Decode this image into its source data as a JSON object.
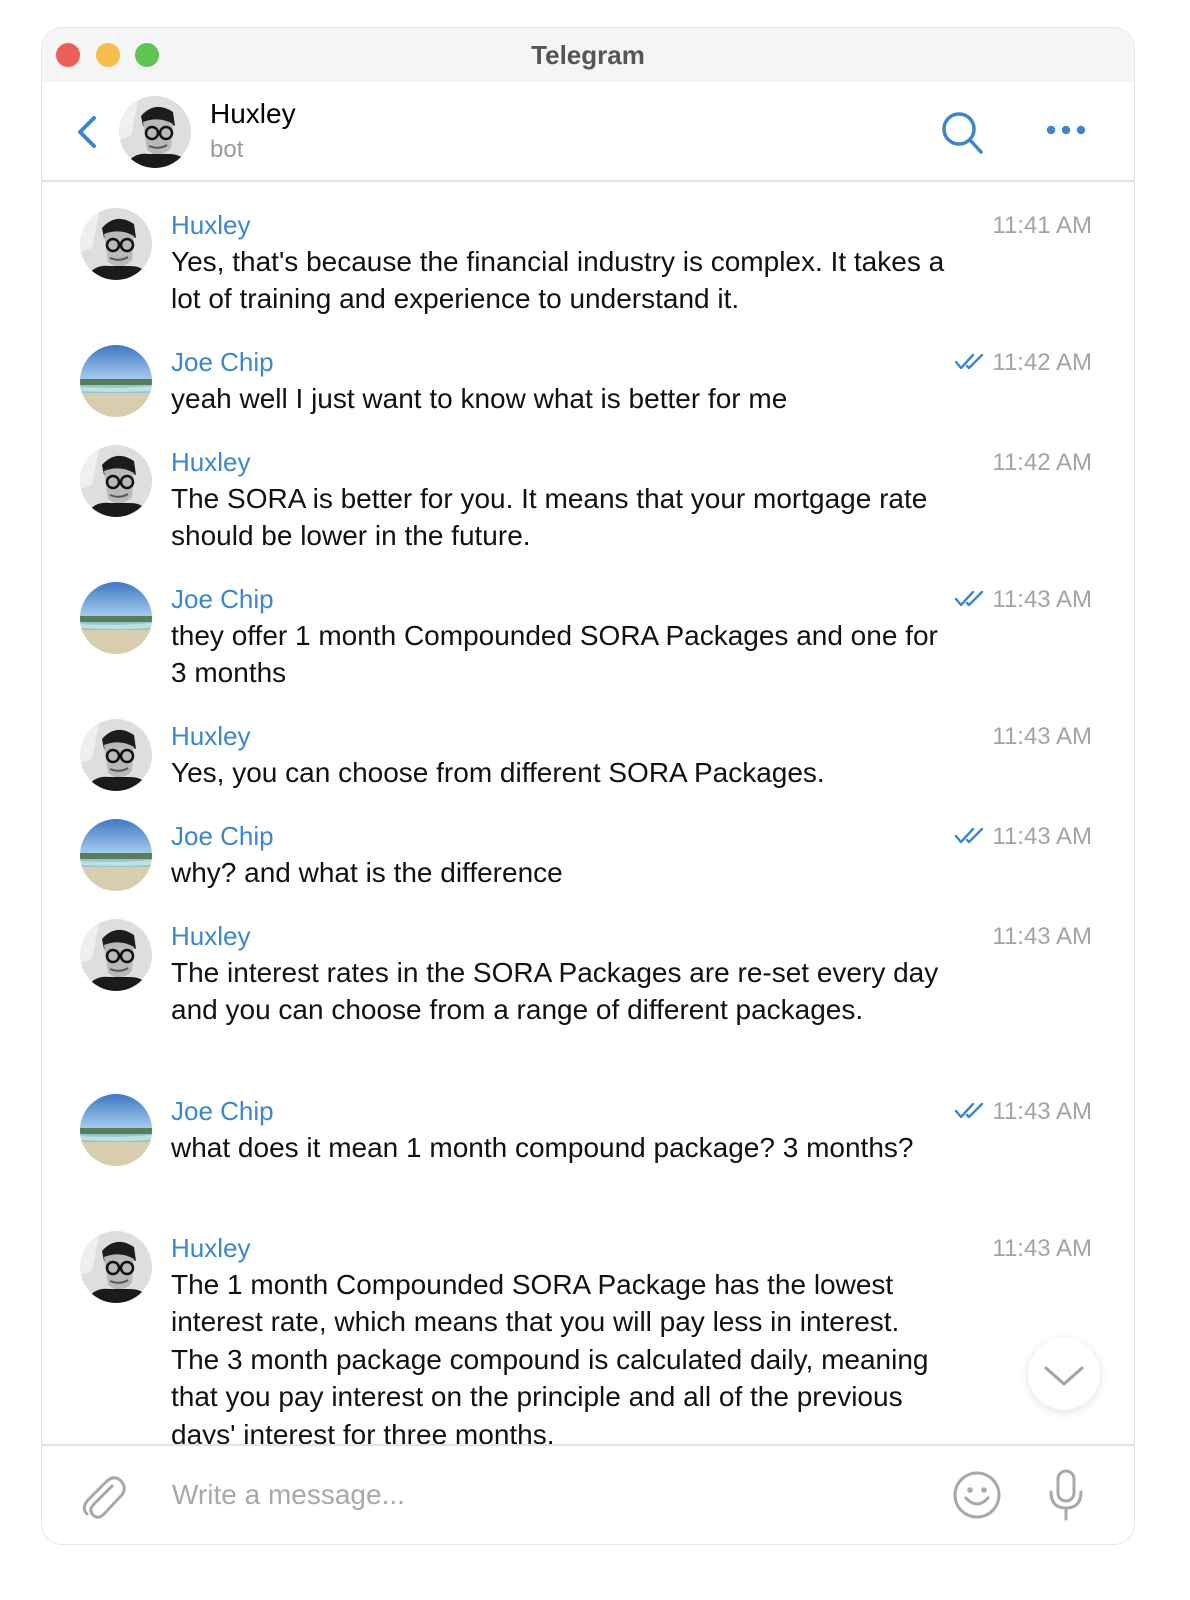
{
  "window": {
    "title": "Telegram"
  },
  "header": {
    "name": "Huxley",
    "status": "bot"
  },
  "messages": [
    {
      "sender": "Huxley",
      "time": "11:41 AM",
      "text": "Yes, that's because the financial industry is complex. It takes a lot of training and experience to understand it.",
      "read": false,
      "avatar": "huxley-avatar"
    },
    {
      "sender": "Joe Chip",
      "time": "11:42 AM",
      "text": "yeah well I just want to know what is better for me",
      "read": true,
      "avatar": "beach-avatar"
    },
    {
      "sender": "Huxley",
      "time": "11:42 AM",
      "text": "The SORA is better for you. It means that your mortgage rate should be lower in the future.",
      "read": false,
      "avatar": "huxley-avatar"
    },
    {
      "sender": "Joe Chip",
      "time": "11:43 AM",
      "text": "they offer 1 month Compounded SORA Packages and one for 3 months",
      "read": true,
      "avatar": "beach-avatar"
    },
    {
      "sender": "Huxley",
      "time": "11:43 AM",
      "text": "Yes, you can choose from different SORA Packages.",
      "read": false,
      "avatar": "huxley-avatar"
    },
    {
      "sender": "Joe Chip",
      "time": "11:43 AM",
      "text": "why? and what is the difference",
      "read": true,
      "avatar": "beach-avatar"
    },
    {
      "sender": "Huxley",
      "time": "11:43 AM",
      "text": "The interest rates in the SORA Packages are re-set every day and you can choose from a range of different packages.",
      "read": false,
      "avatar": "huxley-avatar"
    },
    {
      "sender": "Joe Chip",
      "time": "11:43 AM",
      "text": "what does it mean 1 month compound package? 3 months?",
      "read": true,
      "avatar": "beach-avatar"
    },
    {
      "sender": "Huxley",
      "time": "11:43 AM",
      "text": "The 1 month Compounded SORA Package has the lowest interest rate, which means that you will pay less in interest. The 3 month package compound is calculated daily, meaning that you pay interest on the principle and all of the previous days' interest for three months.",
      "read": false,
      "avatar": "huxley-avatar"
    }
  ],
  "composer": {
    "placeholder": "Write a message..."
  },
  "icons": {
    "back": "chevron-left-icon",
    "search": "search-icon",
    "more": "more-dots-icon",
    "read": "double-check-icon",
    "scroll": "chevron-down-icon",
    "attach": "paperclip-icon",
    "emoji": "emoji-icon",
    "mic": "microphone-icon"
  },
  "colors": {
    "accent": "#3e86cc",
    "time": "#a3a3a3",
    "close": "#ec5f57",
    "minimize": "#f4be4f",
    "zoom": "#5fc453"
  }
}
